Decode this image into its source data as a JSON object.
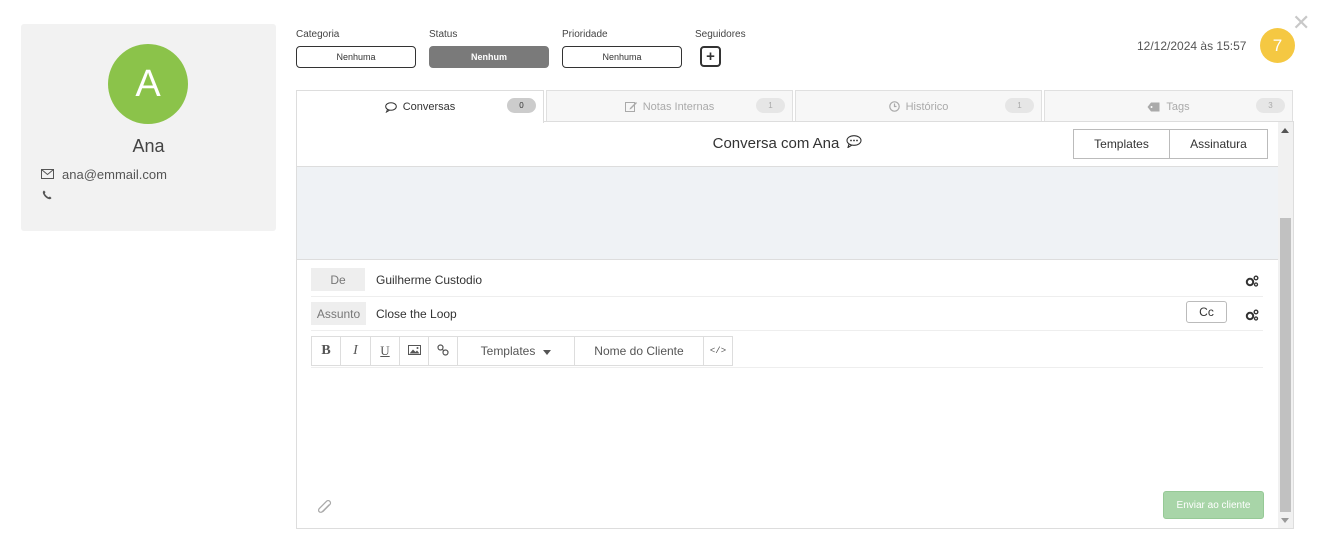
{
  "contact": {
    "avatar_letter": "A",
    "name": "Ana",
    "email": "ana@emmail.com",
    "avatar_color": "#8bc34a"
  },
  "fields": {
    "category": {
      "label": "Categoria",
      "value": "Nenhuma"
    },
    "status": {
      "label": "Status",
      "value": "Nenhum"
    },
    "priority": {
      "label": "Prioridade",
      "value": "Nenhuma"
    },
    "followers": {
      "label": "Seguidores",
      "add_label": "+"
    }
  },
  "header": {
    "datetime": "12/12/2024 às 15:57",
    "counter": "7",
    "counter_color": "#f5c842"
  },
  "tabs": [
    {
      "label": "Conversas",
      "count": "0",
      "icon": "chat-bubble-icon",
      "active": true
    },
    {
      "label": "Notas Internas",
      "count": "1",
      "icon": "edit-note-icon",
      "active": false
    },
    {
      "label": "Histórico",
      "count": "1",
      "icon": "clock-icon",
      "active": false
    },
    {
      "label": "Tags",
      "count": "3",
      "icon": "tag-icon",
      "active": false
    }
  ],
  "conversation": {
    "title": "Conversa com Ana",
    "templates_label": "Templates",
    "signature_label": "Assinatura"
  },
  "compose": {
    "from_label": "De",
    "from_value": "Guilherme Custodio",
    "subject_label": "Assunto",
    "subject_value": "Close the Loop",
    "cc_label": "Cc",
    "toolbar": {
      "bold": "B",
      "italic": "I",
      "underline": "U",
      "templates": "Templates",
      "client_name": "Nome do Cliente",
      "code": "</>"
    },
    "send_label": "Enviar ao cliente",
    "send_color": "#a8d5a8"
  }
}
